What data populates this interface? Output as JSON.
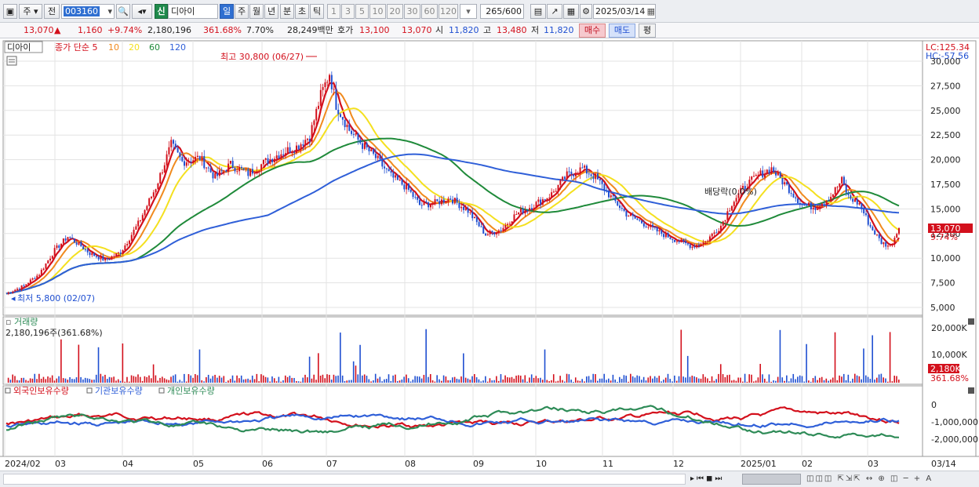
{
  "toolbar": {
    "period_label": "주",
    "prev_label": "전",
    "code": "003160",
    "stock_badge": "신",
    "stock_name": "디아이",
    "tabs": [
      "일",
      "주",
      "월",
      "년",
      "분",
      "초",
      "틱"
    ],
    "active_tab": "일",
    "intervals": [
      "1",
      "3",
      "5",
      "10",
      "20",
      "30",
      "60",
      "120"
    ],
    "count": "265",
    "count_total": "/600",
    "date": "2025/03/14"
  },
  "quote": {
    "price": "13,070",
    "change_arrow": "▲",
    "change": "1,160",
    "change_pct": "+9.74%",
    "volume": "2,180,196",
    "volume_ratio": "361.68%",
    "turnover": "7.70%",
    "amount": "28,249백만",
    "bid_label": "호가",
    "ask_price": "13,100",
    "bid_price": "13,070",
    "open_label": "시",
    "open": "11,820",
    "high_label": "고",
    "high": "13,480",
    "low_label": "저",
    "low": "11,820",
    "buy_label": "매수",
    "sell_label": "매도",
    "eval_label": "평"
  },
  "price_panel": {
    "title": "디아이",
    "ma_legend": [
      {
        "label": "종가 단순 5",
        "color": "#d3101c"
      },
      {
        "label": "10",
        "color": "#f08a1e"
      },
      {
        "label": "20",
        "color": "#f4e01f"
      },
      {
        "label": "60",
        "color": "#1f8a3a"
      },
      {
        "label": "120",
        "color": "#2f5fd8"
      }
    ],
    "lc": "LC:125.34",
    "hc": "HC:-57.56",
    "high_note": "최고 30,800 (06/27)",
    "low_note": "최저 5,800 (02/07)",
    "dividend_note": "배당락(0.0%)",
    "last_price": "13,070",
    "last_pct": "9.74%",
    "y_ticks": [
      "30,000",
      "27,500",
      "25,000",
      "22,500",
      "20,000",
      "17,500",
      "15,000",
      "12,500",
      "10,000",
      "7,500",
      "5,000"
    ]
  },
  "volume_panel": {
    "title": "거래량",
    "value_note": "2,180,196주(361.68%)",
    "y_ticks": [
      "20,000K",
      "10,000K"
    ],
    "last_value": "2,180K",
    "last_pct": "361.68%"
  },
  "holding_panel": {
    "legend": [
      {
        "label": "외국인보유수량",
        "color": "#d3101c"
      },
      {
        "label": "기관보유수량",
        "color": "#2f5fd8"
      },
      {
        "label": "개인보유수량",
        "color": "#2e8b57"
      }
    ],
    "y_ticks": [
      "0",
      "-1,000,000",
      "-2,000,000"
    ]
  },
  "x_axis": {
    "labels": [
      "2024/02",
      "03",
      "04",
      "05",
      "06",
      "07",
      "08",
      "09",
      "10",
      "11",
      "12",
      "2025/01",
      "02",
      "03"
    ],
    "right_label": "03/14"
  },
  "chart_data": {
    "type": "candlestick",
    "price_points": [
      [
        0,
        6400
      ],
      [
        8,
        7200
      ],
      [
        15,
        8400
      ],
      [
        22,
        10800
      ],
      [
        28,
        12200
      ],
      [
        33,
        11400
      ],
      [
        38,
        10500
      ],
      [
        45,
        9800
      ],
      [
        52,
        10600
      ],
      [
        60,
        13500
      ],
      [
        68,
        17200
      ],
      [
        75,
        21500
      ],
      [
        80,
        19800
      ],
      [
        88,
        20200
      ],
      [
        95,
        18200
      ],
      [
        102,
        19500
      ],
      [
        110,
        18600
      ],
      [
        118,
        19800
      ],
      [
        125,
        20700
      ],
      [
        132,
        21300
      ],
      [
        138,
        22400
      ],
      [
        143,
        26500
      ],
      [
        147,
        28800
      ],
      [
        150,
        25600
      ],
      [
        156,
        23000
      ],
      [
        162,
        21500
      ],
      [
        168,
        20200
      ],
      [
        175,
        18300
      ],
      [
        182,
        17200
      ],
      [
        188,
        15400
      ],
      [
        195,
        15600
      ],
      [
        202,
        16100
      ],
      [
        210,
        14800
      ],
      [
        218,
        12400
      ],
      [
        225,
        12900
      ],
      [
        232,
        14500
      ],
      [
        240,
        15400
      ],
      [
        248,
        16500
      ],
      [
        255,
        18400
      ],
      [
        262,
        19100
      ],
      [
        268,
        18200
      ],
      [
        275,
        16200
      ],
      [
        282,
        14500
      ],
      [
        290,
        13500
      ],
      [
        298,
        12500
      ],
      [
        305,
        11800
      ],
      [
        312,
        11200
      ],
      [
        318,
        11700
      ],
      [
        325,
        13300
      ],
      [
        330,
        15600
      ],
      [
        336,
        17300
      ],
      [
        342,
        18400
      ],
      [
        348,
        19100
      ],
      [
        355,
        17300
      ],
      [
        362,
        15400
      ],
      [
        368,
        15200
      ],
      [
        375,
        16300
      ],
      [
        380,
        17900
      ],
      [
        383,
        16200
      ],
      [
        388,
        15500
      ],
      [
        393,
        13200
      ],
      [
        398,
        11600
      ],
      [
        402,
        11200
      ],
      [
        406,
        13070
      ]
    ]
  }
}
